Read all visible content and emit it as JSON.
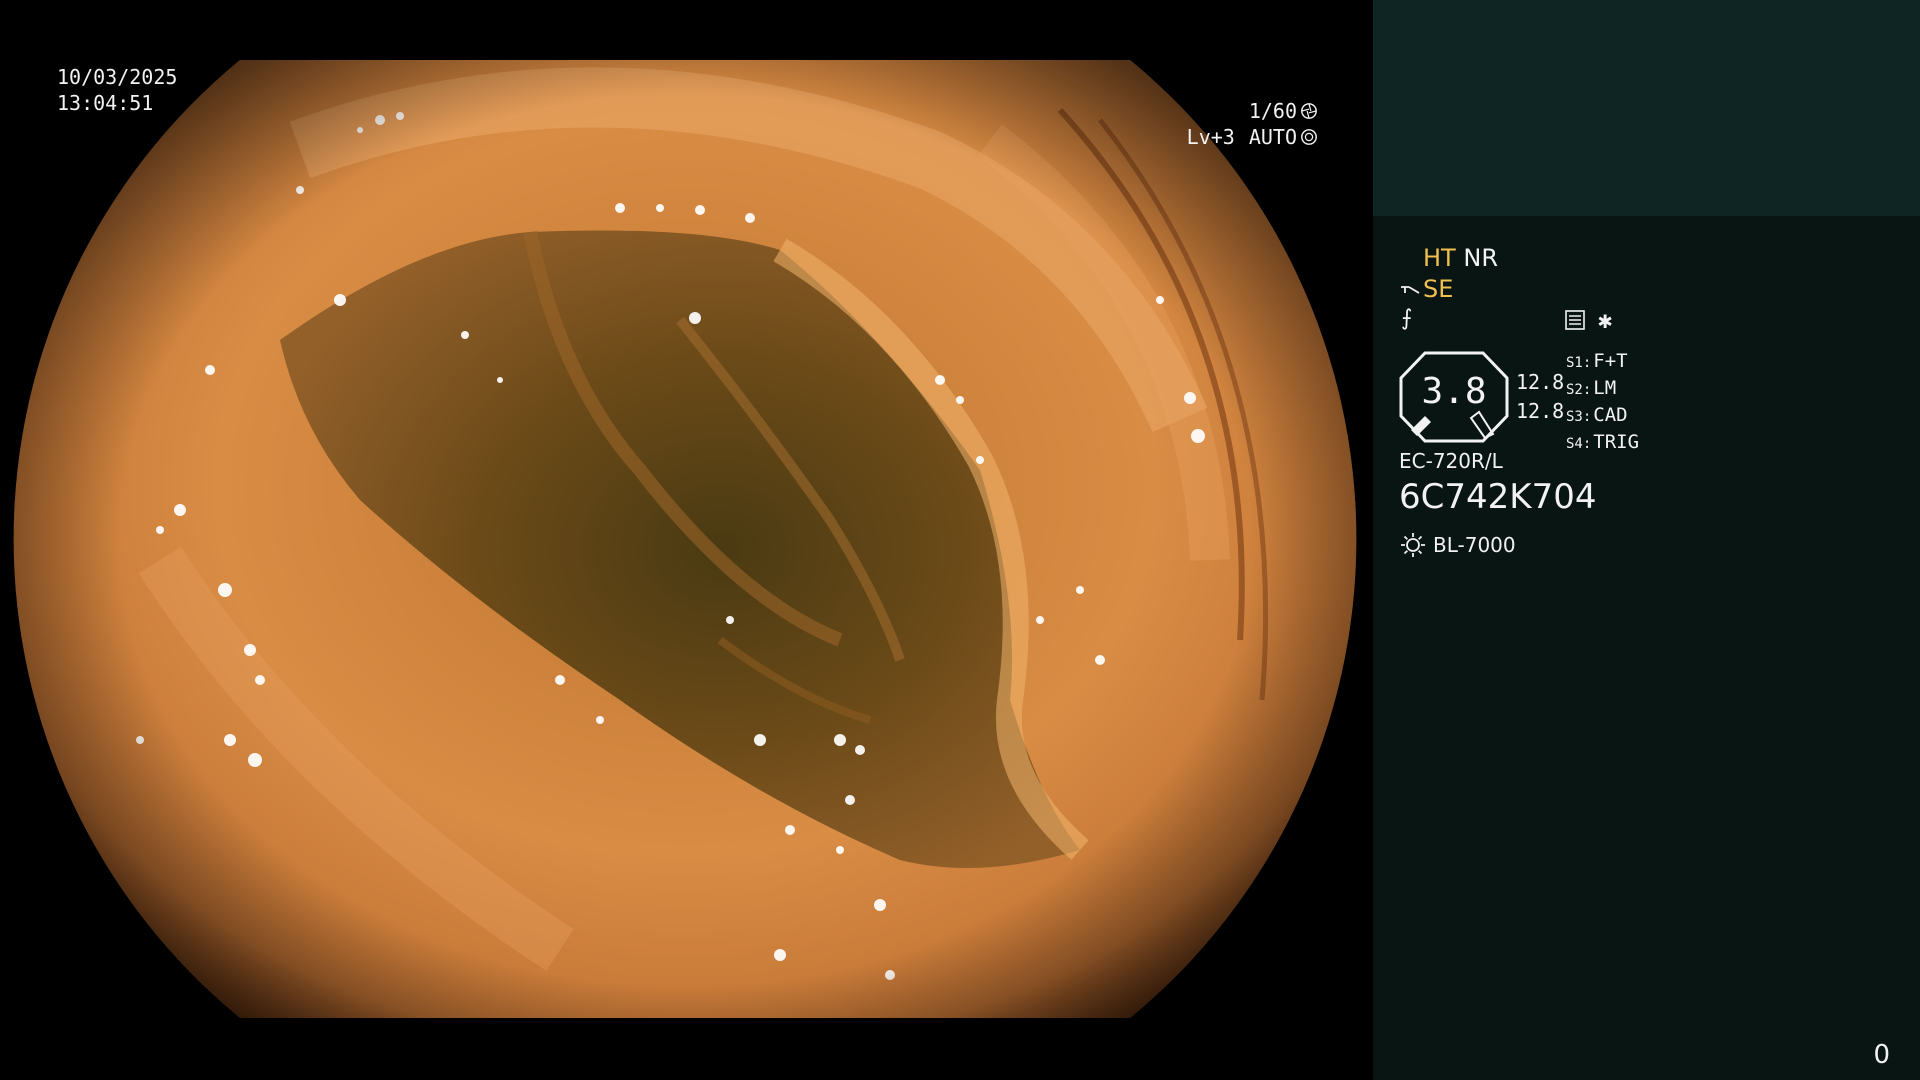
{
  "overlay": {
    "date": "10/03/2025",
    "time": "13:04:51",
    "shutter": "1/60",
    "exposure_level": "Lv+3",
    "exposure_mode": "AUTO"
  },
  "panel": {
    "mode_ht": "HT",
    "mode_nr": "NR",
    "mode_se": "SE",
    "flash_symbol": "⨍",
    "memo_symbol": "✱",
    "gauge_value": "3.8",
    "gauge_line1": "12.8",
    "gauge_line2": "12.8",
    "switches": [
      {
        "key": "S1:",
        "value": "F+T"
      },
      {
        "key": "S2:",
        "value": "LM"
      },
      {
        "key": "S3:",
        "value": "CAD"
      },
      {
        "key": "S4:",
        "value": "TRIG"
      }
    ],
    "scope_model": "EC-720R/L",
    "serial_number": "6C742K704",
    "light_source": "BL-7000"
  },
  "counter": "0",
  "colors": {
    "panel_bg": "#081513",
    "panel_top_bg": "#0f2523",
    "amber": "#f0c050",
    "tissue": "#d98840"
  }
}
